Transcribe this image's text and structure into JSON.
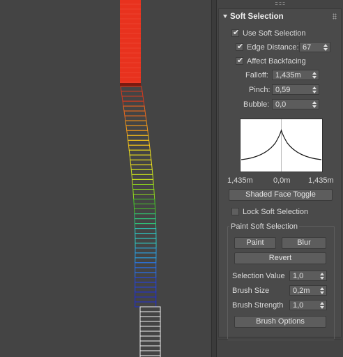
{
  "rollout": {
    "title": "Soft Selection"
  },
  "options": {
    "use_soft_selection": "Use Soft Selection",
    "edge_distance": "Edge Distance:",
    "edge_distance_value": "67",
    "affect_backfacing": "Affect Backfacing"
  },
  "params": {
    "falloff_label": "Falloff:",
    "falloff_value": "1,435m",
    "pinch_label": "Pinch:",
    "pinch_value": "0,59",
    "bubble_label": "Bubble:",
    "bubble_value": "0,0"
  },
  "curve": {
    "left_label": "1,435m",
    "center_label": "0,0m",
    "right_label": "1,435m"
  },
  "buttons": {
    "shaded_face_toggle": "Shaded Face Toggle",
    "lock_soft_selection": "Lock Soft Selection"
  },
  "paint": {
    "group_title": "Paint Soft Selection",
    "paint_label": "Paint",
    "blur_label": "Blur",
    "revert_label": "Revert",
    "selection_value_label": "Selection Value",
    "selection_value": "1,0",
    "brush_size_label": "Brush Size",
    "brush_size": "0,2m",
    "brush_strength_label": "Brush Strength",
    "brush_strength": "1,0",
    "brush_options_label": "Brush Options"
  },
  "checks": {
    "use_soft_selection": true,
    "edge_distance": true,
    "affect_backfacing": true,
    "lock_soft_selection": false
  },
  "colors": {
    "panel_bg": "#444444",
    "rollout_bg": "#4a4a4a",
    "field_bg": "#5c5c5c",
    "selected_red": "#e8321e"
  }
}
